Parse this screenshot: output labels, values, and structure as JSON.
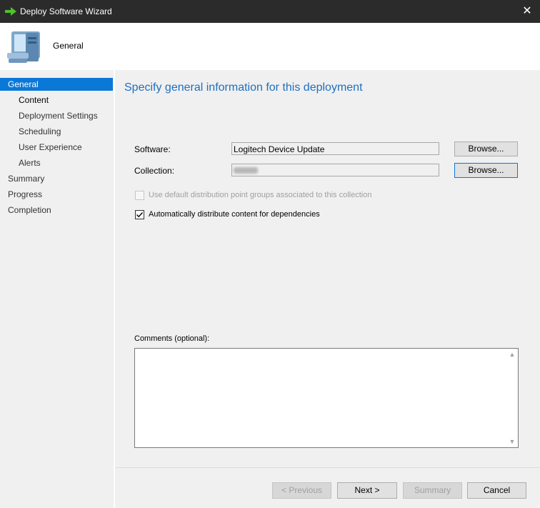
{
  "window": {
    "title": "Deploy Software Wizard",
    "close_glyph": "✕"
  },
  "header": {
    "title": "General"
  },
  "sidebar": {
    "items": [
      {
        "label": "General"
      },
      {
        "label": "Content"
      },
      {
        "label": "Deployment Settings"
      },
      {
        "label": "Scheduling"
      },
      {
        "label": "User Experience"
      },
      {
        "label": "Alerts"
      },
      {
        "label": "Summary"
      },
      {
        "label": "Progress"
      },
      {
        "label": "Completion"
      }
    ]
  },
  "main": {
    "heading": "Specify general information for this deployment",
    "software_label": "Software:",
    "software_value": "Logitech Device Update",
    "collection_label": "Collection:",
    "browse_label": "Browse...",
    "default_dp_label": "Use default distribution point groups associated to this collection",
    "default_dp_checked": false,
    "auto_distribute_label": "Automatically distribute content for dependencies",
    "auto_distribute_checked": true,
    "comments_label": "Comments (optional):",
    "comments_value": ""
  },
  "footer": {
    "previous_label": "< Previous",
    "next_label": "Next >",
    "summary_label": "Summary",
    "cancel_label": "Cancel"
  },
  "colors": {
    "accent": "#0a78d7",
    "heading": "#1f6fc0",
    "titlebar": "#2b2b2b"
  }
}
